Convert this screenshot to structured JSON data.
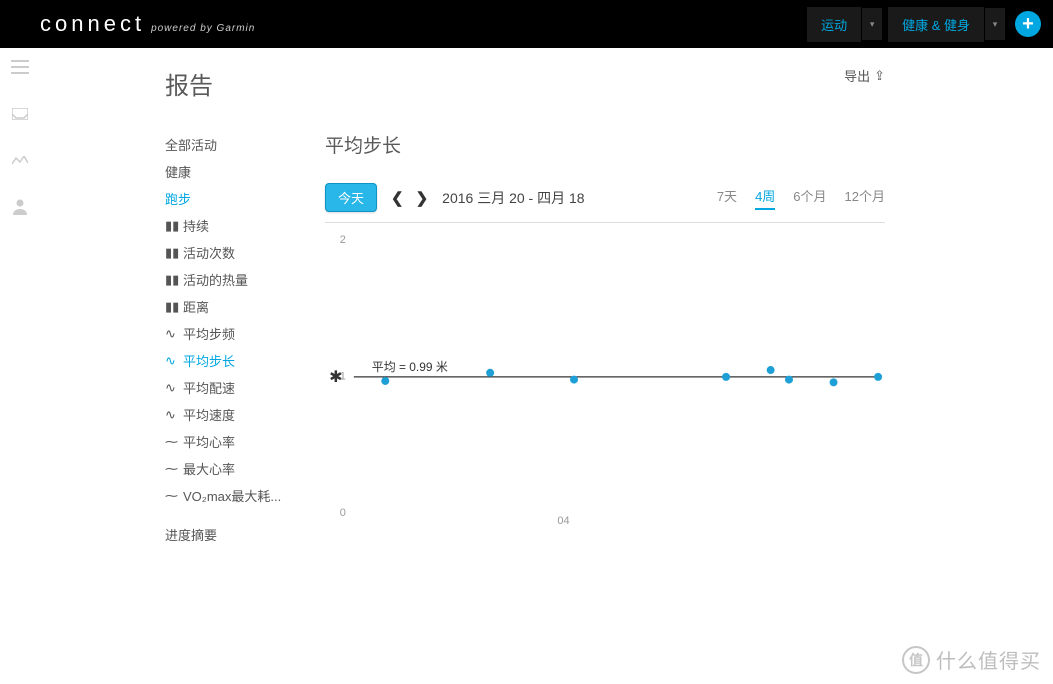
{
  "header": {
    "logo_main": "connect",
    "logo_sub": "powered by Garmin",
    "nav_sport": "运动",
    "nav_health": "健康 & 健身"
  },
  "toolbar": {
    "export_label": "导出"
  },
  "page_title": "报告",
  "sidebar": {
    "categories": {
      "all": "全部活动",
      "health": "健康",
      "running": "跑步"
    },
    "metrics": {
      "duration": "持续",
      "activity_count": "活动次数",
      "activity_calories": "活动的热量",
      "distance": "距离",
      "avg_cadence": "平均步频",
      "avg_stride": "平均步长",
      "avg_pace": "平均配速",
      "avg_speed": "平均速度",
      "avg_hr": "平均心率",
      "max_hr": "最大心率",
      "vo2max": "VO₂max最大耗..."
    },
    "summary": "进度摘要"
  },
  "chart": {
    "title": "平均步长",
    "today_btn": "今天",
    "date_range": "2016 三月 20 - 四月 18",
    "ranges": {
      "r7d": "7天",
      "r4w": "4周",
      "r6m": "6个月",
      "r12m": "12个月"
    },
    "avg_label": "平均 = 0.99 米",
    "chart_data": {
      "type": "scatter",
      "xlabel": "",
      "ylabel": "",
      "ylim": [
        0,
        2
      ],
      "y_ticks": [
        0,
        1,
        2
      ],
      "x_ticks": [
        "04"
      ],
      "avg_line": 0.99,
      "points": [
        {
          "x": 0.06,
          "y": 0.96
        },
        {
          "x": 0.26,
          "y": 1.02
        },
        {
          "x": 0.42,
          "y": 0.97
        },
        {
          "x": 0.71,
          "y": 0.99
        },
        {
          "x": 0.795,
          "y": 1.04
        },
        {
          "x": 0.83,
          "y": 0.97
        },
        {
          "x": 0.915,
          "y": 0.95
        },
        {
          "x": 1.0,
          "y": 0.99
        }
      ]
    }
  },
  "watermark": "什么值得买"
}
